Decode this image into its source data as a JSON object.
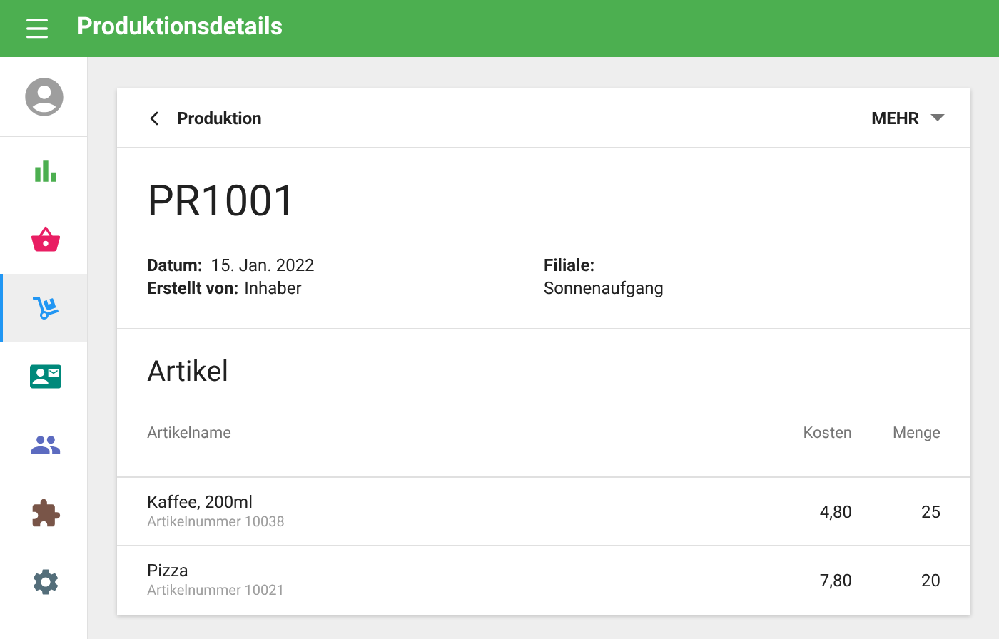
{
  "app_bar": {
    "title": "Produktionsdetails"
  },
  "sidebar": {
    "items": [
      {
        "kind": "chart",
        "color": "#4caf50",
        "selected": false
      },
      {
        "kind": "basket",
        "color": "#e91e63",
        "selected": false
      },
      {
        "kind": "trolley",
        "color": "#2196f3",
        "selected": true
      },
      {
        "kind": "card",
        "color": "#00897b",
        "selected": false
      },
      {
        "kind": "people",
        "color": "#5c6bc0",
        "selected": false
      },
      {
        "kind": "puzzle",
        "color": "#795548",
        "selected": false
      },
      {
        "kind": "gear",
        "color": "#546e7a",
        "selected": false
      }
    ]
  },
  "toolbar": {
    "back_label": "Produktion",
    "menu_label": "MEHR"
  },
  "production": {
    "id": "PR1001",
    "date_label": "Datum:",
    "date": "15. Jan. 2022",
    "creator_label": "Erstellt von:",
    "creator": "Inhaber",
    "branch_label": "Filiale:",
    "branch": "Sonnenaufgang"
  },
  "articles": {
    "title": "Artikel",
    "columns": [
      "Artikelname",
      "Kosten",
      "Menge"
    ],
    "rows": [
      {
        "name": "Kaffee, 200ml",
        "number": "Artikelnummer 10038",
        "cost": "4,80",
        "quantity": "25"
      },
      {
        "name": "Pizza",
        "number": "Artikelnummer 10021",
        "cost": "7,80",
        "quantity": "20"
      }
    ]
  }
}
